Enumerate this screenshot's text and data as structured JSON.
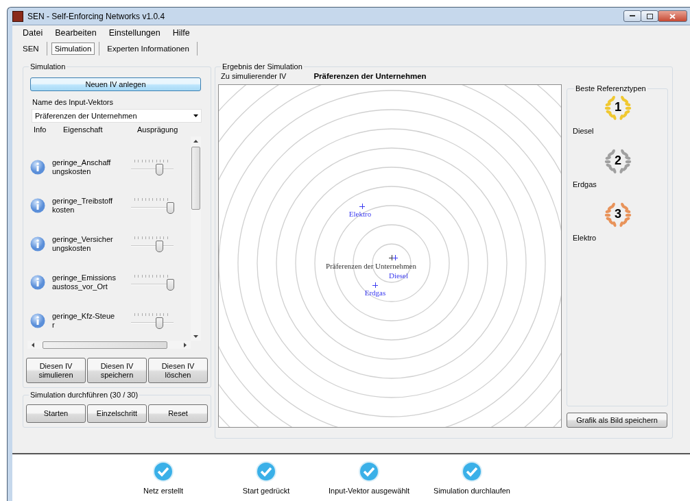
{
  "window": {
    "title": "SEN - Self-Enforcing Networks v1.0.4"
  },
  "menu": [
    "Datei",
    "Bearbeiten",
    "Einstellungen",
    "Hilfe"
  ],
  "tabs": [
    {
      "label": "SEN",
      "selected": false
    },
    {
      "label": "Simulation",
      "selected": true
    },
    {
      "label": "Experten Informationen",
      "selected": false
    }
  ],
  "simulation": {
    "title": "Simulation",
    "new_button": "Neuen IV anlegen",
    "name_label": "Name des Input-Vektors",
    "name_value": "Präferenzen der Unternehmen",
    "columns": [
      "Info",
      "Eigenschaft",
      "Ausprägung"
    ],
    "rows": [
      {
        "name": "geringe_Anschaff\nungskosten",
        "level": 0.7
      },
      {
        "name": "geringe_Treibstoff\nkosten",
        "level": 1
      },
      {
        "name": "geringe_Versicher\nungskosten",
        "level": 0.7
      },
      {
        "name": "geringe_Emissions\naustoss_vor_Ort",
        "level": 1
      },
      {
        "name": "geringe_Kfz-Steue\nr",
        "level": 0.7
      }
    ],
    "buttons": [
      "Diesen IV\nsimulieren",
      "Diesen IV\nspeichern",
      "Diesen IV\nlöschen"
    ]
  },
  "run": {
    "title": "Simulation durchführen (30 / 30)",
    "buttons": [
      "Starten",
      "Einzelschritt",
      "Reset"
    ]
  },
  "result": {
    "title": "Ergebnis der Simulation",
    "iv_label": "Zu simulierender IV",
    "iv_value": "Präferenzen der Unternehmen",
    "points": [
      {
        "label": "Elektro",
        "kind": "reference"
      },
      {
        "label": "Erdgas",
        "kind": "reference"
      },
      {
        "label": "Präferenzen der Unternehmen",
        "kind": "input"
      },
      {
        "label": "Diesel",
        "kind": "reference"
      }
    ],
    "ranking": {
      "title": "Beste Referenztypen",
      "items": [
        {
          "rank": "1",
          "name": "Diesel",
          "color": "#f0c830"
        },
        {
          "rank": "2",
          "name": "Erdgas",
          "color": "#a0a0a0"
        },
        {
          "rank": "3",
          "name": "Elektro",
          "color": "#e8935a"
        }
      ]
    },
    "save_button": "Grafik als Bild speichern"
  },
  "status": [
    {
      "label": "Netz erstellt",
      "done": true
    },
    {
      "label": "Start gedrückt",
      "done": true
    },
    {
      "label": "Input-Vektor ausgewählt",
      "done": true
    },
    {
      "label": "Simulation durchlaufen",
      "done": true
    }
  ]
}
